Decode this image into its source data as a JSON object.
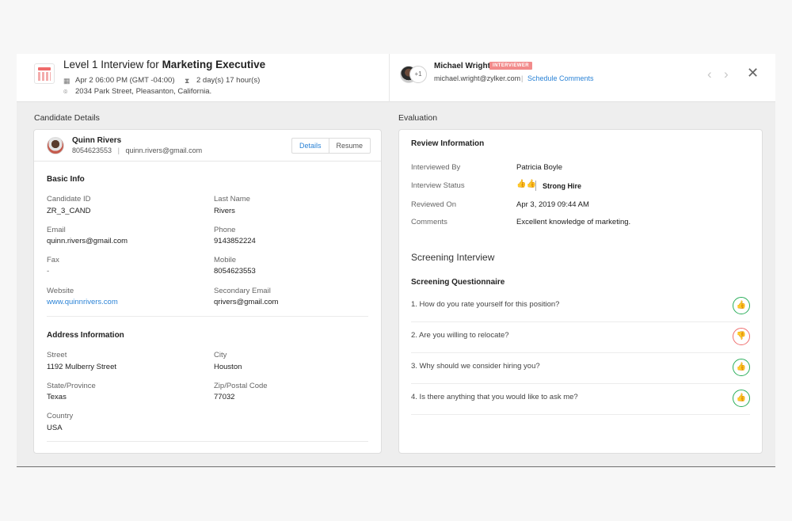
{
  "header": {
    "title_prefix": "Level 1 Interview for ",
    "title_role": "Marketing Executive",
    "datetime": "Apr 2 06:00 PM (GMT -04:00)",
    "duration": "2 day(s) 17 hour(s)",
    "location": "2034 Park Street, Pleasanton, California.",
    "interviewer_name": "Michael Wright",
    "interviewer_badge": "INTERVIEWER",
    "interviewer_email": "michael.wright@zylker.com",
    "separator": "|",
    "schedule_comments": "Schedule Comments",
    "extra_count": "+1"
  },
  "candidate_section": {
    "heading": "Candidate Details",
    "name": "Quinn Rivers",
    "phone": "8054623553",
    "email": "quinn.rivers@gmail.com",
    "tabs": [
      "Details",
      "Resume"
    ],
    "basic_info_title": "Basic Info",
    "basic_fields": [
      {
        "label": "Candidate ID",
        "value": "ZR_3_CAND"
      },
      {
        "label": "Last Name",
        "value": "Rivers"
      },
      {
        "label": "Email",
        "value": "quinn.rivers@gmail.com"
      },
      {
        "label": "Phone",
        "value": "9143852224"
      },
      {
        "label": "Fax",
        "value": "-"
      },
      {
        "label": "Mobile",
        "value": "8054623553"
      },
      {
        "label": "Website",
        "value": "www.quinnrivers.com"
      },
      {
        "label": "Secondary Email",
        "value": "qrivers@gmail.com"
      }
    ],
    "address_title": "Address Information",
    "address_fields": [
      {
        "label": "Street",
        "value": "1192 Mulberry Street"
      },
      {
        "label": "City",
        "value": "Houston"
      },
      {
        "label": "State/Province",
        "value": "Texas"
      },
      {
        "label": "Zip/Postal Code",
        "value": "77032"
      },
      {
        "label": "Country",
        "value": "USA"
      }
    ]
  },
  "evaluation": {
    "heading": "Evaluation",
    "review_title": "Review Information",
    "interviewed_by_label": "Interviewed By",
    "interviewed_by": "Patricia Boyle",
    "status_label": "Interview Status",
    "status": "Strong Hire",
    "reviewed_on_label": "Reviewed On",
    "reviewed_on": "Apr 3, 2019 09:44 AM",
    "comments_label": "Comments",
    "comments": "Excellent knowledge of marketing.",
    "screening_title": "Screening Interview",
    "questionnaire_title": "Screening Questionnaire",
    "questions": [
      {
        "text": "1.  How do you rate yourself for this position?",
        "rating": "thumbs-up"
      },
      {
        "text": "2.  Are you willing to relocate?",
        "rating": "thumbs-down"
      },
      {
        "text": "3.  Why should we consider hiring you?",
        "rating": "thumbs-up"
      },
      {
        "text": "4.  Is there anything that you would like to ask me?",
        "rating": "thumbs-up"
      }
    ]
  },
  "colors": {
    "accent": "#2b83d6",
    "positive": "#2aae5a",
    "negative": "#ef6f6f",
    "badge": "#f28b8b"
  }
}
